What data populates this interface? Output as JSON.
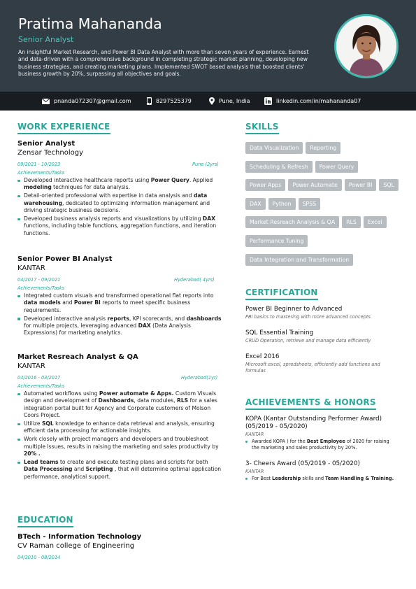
{
  "header": {
    "name": "Pratima Mahananda",
    "role": "Senior Analyst",
    "summary": "An insightful Market Research, and Power BI Data Analyst with more than seven years of experience. Earnest and data-driven with a comprehensive background in completing strategic market planning, developing new business strategies, and creating marketing plans. Implemented SWOT based analysis that boosted clients' business growth by 20%, surpassing all objectives and goals."
  },
  "contact": {
    "email": "pnanda072307@gmail.com",
    "phone": "8297525379",
    "location": "Pune, India",
    "linkedin": "linkedin.com/in/mahananda07"
  },
  "colors": {
    "accent": "#28a899",
    "header_bg": "#333d46",
    "contact_bg": "#191d21",
    "tag_bg": "#b7bcc0"
  },
  "sections": {
    "work": "WORK EXPERIENCE",
    "education": "EDUCATION",
    "skills": "SKILLS",
    "certification": "CERTIFICATION",
    "achievements": "ACHIEVEMENTS & HONORS"
  },
  "jobs": [
    {
      "title": "Senior Analyst",
      "company": "Zensar Technology",
      "dates": "09/2021 - 10/2023",
      "location": "Pune (2yrs)",
      "label": "Achievements/Tasks",
      "bullets": [
        [
          "Developed interactive healthcare reports using ",
          "Power Query",
          ". Applied ",
          "modeling",
          " techniques for data analysis."
        ],
        [
          "Detail-oriented professional with expertise in data analysis and ",
          "data warehousing",
          ", dedicated to optimizing information management and driving strategic business decisions."
        ],
        [
          "Developed business analysis reports and visualizations by utilizing ",
          "DAX",
          " functions, including table functions, aggregation functions, and iteration functions."
        ]
      ]
    },
    {
      "title": "Senior Power BI Analyst",
      "company": "KANTAR",
      "dates": "04/2017 - 09/2021",
      "location": "Hyderabad( 4yrs)",
      "label": "Achievements/Tasks",
      "bullets": [
        [
          "Integrated custom visuals and transformed operational flat reports into ",
          "data models",
          " and ",
          "Power BI",
          " reports to meet specific business requirements."
        ],
        [
          "Developed interactive analysis ",
          "reports",
          ", KPI scorecards, and ",
          "dashboards",
          " for multiple projects, leveraging advanced ",
          "DAX",
          " (Data Analysis Expressions) for marketing analytics."
        ]
      ]
    },
    {
      "title": "Market Resreach Analyst & QA",
      "company": "KANTAR",
      "dates": "04/2016 - 03/2017",
      "location": "Hyderabad(1yr)",
      "label": "Achievements/Tasks",
      "bullets": [
        [
          "Automated workflows using ",
          "Power automate & Apps.",
          " Custom Visuals design and development of ",
          "Dashboards",
          ", data modules, ",
          "RLS",
          " for a sales integration portal built for Agency and Corporate customers of Molson Coors Project."
        ],
        [
          "Utilize ",
          "SQL",
          " knowledge to enhance data retrieval and analysis, ensuring efficient data processing for actionable insights."
        ],
        [
          "Work closely with project managers and developers and troubleshoot multiple Issues, results in raising the marketing and sales productivity by ",
          "20% .",
          ""
        ],
        [
          "",
          "Lead teams",
          " to create and execute testing plans and scripts for both ",
          "Data Processing",
          " and ",
          "Scripting",
          " , that will determine optimal application performance, analytical support."
        ]
      ]
    }
  ],
  "education": {
    "degree": "BTech - Information Technology",
    "school": "CV Raman college of Engineering",
    "dates": "04/2010 - 08/2014"
  },
  "skills": [
    "Data Visualization",
    "Reporting",
    "Scheduling & Refresh",
    "Power Query",
    "Power Apps",
    "Power Automate",
    "Power BI",
    "SQL",
    "DAX",
    "Python",
    "SPSS",
    "Market Resreach Analysis & QA",
    "RLS",
    "Excel",
    "Performance Tuning",
    "Data Integration and Transformation"
  ],
  "certifications": [
    {
      "name": "Power BI Beginner to Advanced",
      "desc": "PBI basics to mastering with more advanced concepts"
    },
    {
      "name": "SQL Essential Training",
      "desc": "CRUD Operation, retrieve and manage data efficiently"
    },
    {
      "name": "Excel 2016",
      "desc": "Microsoft excel, spredsheets, efficiently add functions and formulas"
    }
  ],
  "achievements": [
    {
      "title": "KOPA (Kantar Outstanding Performer Award) (05/2019 - 05/2020)",
      "org": "KANTAR",
      "bullet": [
        "Awarded KOPA ) for the ",
        "Best Employee",
        " of 2020 for raising the marketing and sales productivity by 20%."
      ]
    },
    {
      "title": "3- Cheers Award (05/2019 - 05/2020)",
      "org": "KANTAR",
      "bullet": [
        "For Best ",
        "Leadership",
        " skills and ",
        "Team Handling & Training.",
        ""
      ]
    }
  ]
}
